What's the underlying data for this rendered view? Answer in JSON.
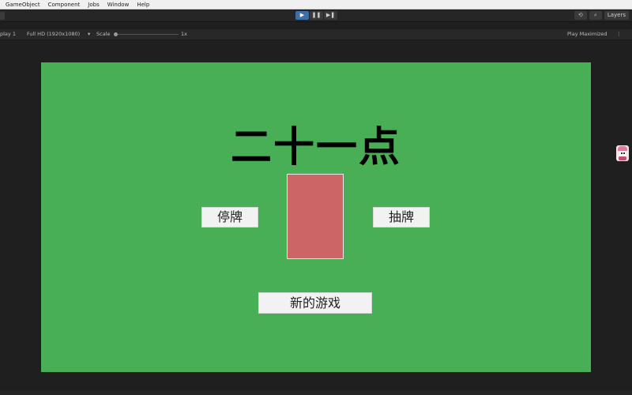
{
  "menu": {
    "items": [
      "GameObject",
      "Component",
      "Jobs",
      "Window",
      "Help"
    ]
  },
  "toolbar": {
    "play_icon": "▶",
    "pause_icon": "❚❚",
    "step_icon": "▶❚",
    "history_icon": "⟲",
    "search_icon": "⌕",
    "layers_label": "Layers"
  },
  "game_view": {
    "display_label": "play 1",
    "resolution_label": "Full HD (1920x1080)",
    "dropdown_arrow": "▾",
    "scale_label": "Scale",
    "scale_value": "1x",
    "play_mode_label": "Play Maximized",
    "menu_dots": "⋮"
  },
  "game": {
    "title": "二十一点",
    "stand_button": "停牌",
    "hit_button": "抽牌",
    "new_game_button": "新的游戏",
    "colors": {
      "table": "#49af57",
      "card_back": "#cc6666"
    }
  }
}
